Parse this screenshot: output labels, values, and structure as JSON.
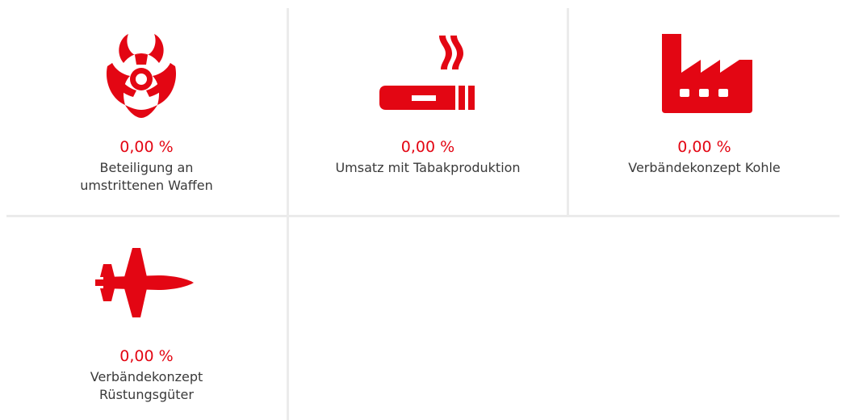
{
  "brand_color": "#e30613",
  "items": [
    {
      "icon": "biohazard-icon",
      "value": "0,00 %",
      "label": "Beteiligung an\numstrittenen Waffen"
    },
    {
      "icon": "cigarette-icon",
      "value": "0,00 %",
      "label": "Umsatz mit Tabakproduktion"
    },
    {
      "icon": "factory-icon",
      "value": "0,00 %",
      "label": "Verbändekonzept Kohle"
    },
    {
      "icon": "fighter-jet-icon",
      "value": "0,00 %",
      "label": "Verbändekonzept\nRüstungsgüter"
    }
  ]
}
